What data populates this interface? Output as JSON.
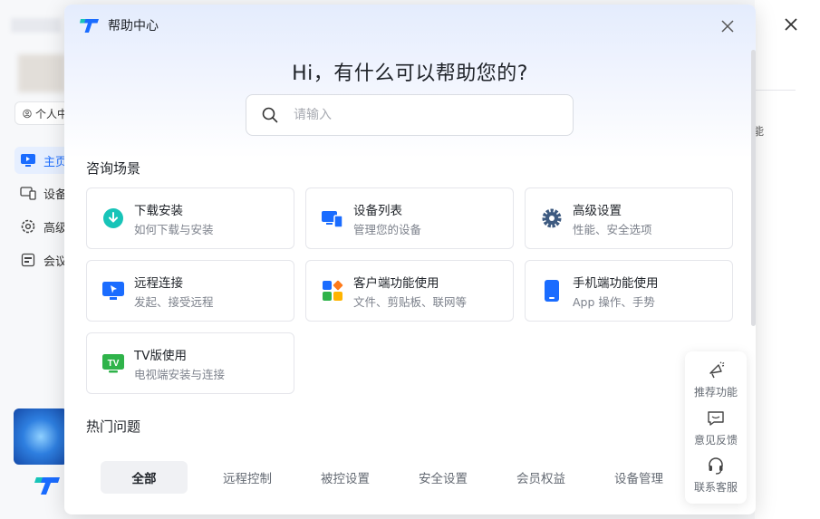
{
  "background_app": {
    "user_label": "个人中",
    "nav_items": [
      {
        "label": "主页",
        "icon": "monitor-icon"
      },
      {
        "label": "设备",
        "icon": "devices-icon"
      },
      {
        "label": "高级",
        "icon": "gear-icon"
      },
      {
        "label": "会议",
        "icon": "meeting-icon"
      }
    ],
    "right_char": "能"
  },
  "modal": {
    "title": "帮助中心",
    "greeting": "Hi，有什么可以帮助您的?",
    "search": {
      "placeholder": "请输入",
      "value": ""
    },
    "scenarios_title": "咨询场景",
    "scenarios": [
      {
        "title": "下载安装",
        "subtitle": "如何下载与安装",
        "icon": "download-icon",
        "color": "#17c4b8"
      },
      {
        "title": "设备列表",
        "subtitle": "管理您的设备",
        "icon": "device-list-icon",
        "color": "#1a6cff"
      },
      {
        "title": "高级设置",
        "subtitle": "性能、安全选项",
        "icon": "settings-gear-icon",
        "color": "#3d5a80"
      },
      {
        "title": "远程连接",
        "subtitle": "发起、接受远程",
        "icon": "remote-monitor-icon",
        "color": "#1a6cff"
      },
      {
        "title": "客户端功能使用",
        "subtitle": "文件、剪贴板、联网等",
        "icon": "apps-grid-icon",
        "color": "#1a6cff"
      },
      {
        "title": "手机端功能使用",
        "subtitle": "App 操作、手势",
        "icon": "phone-icon",
        "color": "#1a6cff"
      },
      {
        "title": "TV版使用",
        "subtitle": "电视端安装与连接",
        "icon": "tv-icon",
        "color": "#2fb34a"
      }
    ],
    "hot_title": "热门问题",
    "tabs": [
      "全部",
      "远程控制",
      "被控设置",
      "安全设置",
      "会员权益",
      "设备管理"
    ],
    "active_tab": "全部",
    "float_actions": [
      {
        "label": "推荐功能",
        "icon": "megaphone-icon"
      },
      {
        "label": "意见反馈",
        "icon": "feedback-icon"
      },
      {
        "label": "联系客服",
        "icon": "headset-icon"
      }
    ]
  }
}
